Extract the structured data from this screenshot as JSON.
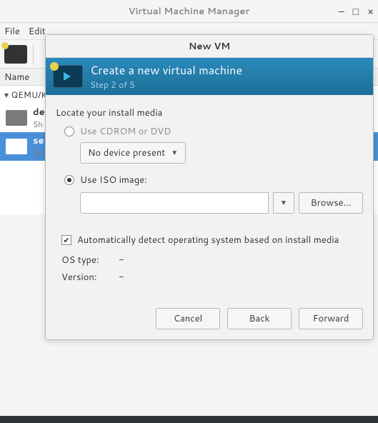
{
  "window": {
    "title": "Virtual Machine Manager",
    "menu": {
      "file": "File",
      "edit": "Edit"
    },
    "name_header": "Name",
    "tree": {
      "group": "QEMU/K",
      "rows": [
        {
          "name": "de",
          "state": "Sh"
        },
        {
          "name": "se",
          "state": "Sh"
        }
      ]
    }
  },
  "dialog": {
    "title": "New VM",
    "header_title": "Create a new virtual machine",
    "step": "Step 2 of 5",
    "locate_label": "Locate your install media",
    "radio_cd": "Use CDROM or DVD",
    "combo_cd": "No device present",
    "radio_iso": "Use ISO image:",
    "iso_value": "",
    "browse": "Browse...",
    "autodetect": "Automatically detect operating system based on install media",
    "os_type_label": "OS type:",
    "os_type_value": "-",
    "version_label": "Version:",
    "version_value": "-",
    "cancel": "Cancel",
    "back": "Back",
    "forward": "Forward"
  }
}
